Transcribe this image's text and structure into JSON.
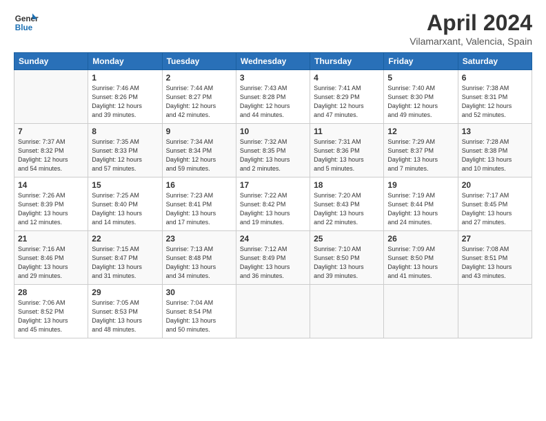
{
  "header": {
    "logo_line1": "General",
    "logo_line2": "Blue",
    "title": "April 2024",
    "subtitle": "Vilamarxant, Valencia, Spain"
  },
  "days_of_week": [
    "Sunday",
    "Monday",
    "Tuesday",
    "Wednesday",
    "Thursday",
    "Friday",
    "Saturday"
  ],
  "weeks": [
    [
      {
        "day": "",
        "info": ""
      },
      {
        "day": "1",
        "info": "Sunrise: 7:46 AM\nSunset: 8:26 PM\nDaylight: 12 hours\nand 39 minutes."
      },
      {
        "day": "2",
        "info": "Sunrise: 7:44 AM\nSunset: 8:27 PM\nDaylight: 12 hours\nand 42 minutes."
      },
      {
        "day": "3",
        "info": "Sunrise: 7:43 AM\nSunset: 8:28 PM\nDaylight: 12 hours\nand 44 minutes."
      },
      {
        "day": "4",
        "info": "Sunrise: 7:41 AM\nSunset: 8:29 PM\nDaylight: 12 hours\nand 47 minutes."
      },
      {
        "day": "5",
        "info": "Sunrise: 7:40 AM\nSunset: 8:30 PM\nDaylight: 12 hours\nand 49 minutes."
      },
      {
        "day": "6",
        "info": "Sunrise: 7:38 AM\nSunset: 8:31 PM\nDaylight: 12 hours\nand 52 minutes."
      }
    ],
    [
      {
        "day": "7",
        "info": "Sunrise: 7:37 AM\nSunset: 8:32 PM\nDaylight: 12 hours\nand 54 minutes."
      },
      {
        "day": "8",
        "info": "Sunrise: 7:35 AM\nSunset: 8:33 PM\nDaylight: 12 hours\nand 57 minutes."
      },
      {
        "day": "9",
        "info": "Sunrise: 7:34 AM\nSunset: 8:34 PM\nDaylight: 12 hours\nand 59 minutes."
      },
      {
        "day": "10",
        "info": "Sunrise: 7:32 AM\nSunset: 8:35 PM\nDaylight: 13 hours\nand 2 minutes."
      },
      {
        "day": "11",
        "info": "Sunrise: 7:31 AM\nSunset: 8:36 PM\nDaylight: 13 hours\nand 5 minutes."
      },
      {
        "day": "12",
        "info": "Sunrise: 7:29 AM\nSunset: 8:37 PM\nDaylight: 13 hours\nand 7 minutes."
      },
      {
        "day": "13",
        "info": "Sunrise: 7:28 AM\nSunset: 8:38 PM\nDaylight: 13 hours\nand 10 minutes."
      }
    ],
    [
      {
        "day": "14",
        "info": "Sunrise: 7:26 AM\nSunset: 8:39 PM\nDaylight: 13 hours\nand 12 minutes."
      },
      {
        "day": "15",
        "info": "Sunrise: 7:25 AM\nSunset: 8:40 PM\nDaylight: 13 hours\nand 14 minutes."
      },
      {
        "day": "16",
        "info": "Sunrise: 7:23 AM\nSunset: 8:41 PM\nDaylight: 13 hours\nand 17 minutes."
      },
      {
        "day": "17",
        "info": "Sunrise: 7:22 AM\nSunset: 8:42 PM\nDaylight: 13 hours\nand 19 minutes."
      },
      {
        "day": "18",
        "info": "Sunrise: 7:20 AM\nSunset: 8:43 PM\nDaylight: 13 hours\nand 22 minutes."
      },
      {
        "day": "19",
        "info": "Sunrise: 7:19 AM\nSunset: 8:44 PM\nDaylight: 13 hours\nand 24 minutes."
      },
      {
        "day": "20",
        "info": "Sunrise: 7:17 AM\nSunset: 8:45 PM\nDaylight: 13 hours\nand 27 minutes."
      }
    ],
    [
      {
        "day": "21",
        "info": "Sunrise: 7:16 AM\nSunset: 8:46 PM\nDaylight: 13 hours\nand 29 minutes."
      },
      {
        "day": "22",
        "info": "Sunrise: 7:15 AM\nSunset: 8:47 PM\nDaylight: 13 hours\nand 31 minutes."
      },
      {
        "day": "23",
        "info": "Sunrise: 7:13 AM\nSunset: 8:48 PM\nDaylight: 13 hours\nand 34 minutes."
      },
      {
        "day": "24",
        "info": "Sunrise: 7:12 AM\nSunset: 8:49 PM\nDaylight: 13 hours\nand 36 minutes."
      },
      {
        "day": "25",
        "info": "Sunrise: 7:10 AM\nSunset: 8:50 PM\nDaylight: 13 hours\nand 39 minutes."
      },
      {
        "day": "26",
        "info": "Sunrise: 7:09 AM\nSunset: 8:50 PM\nDaylight: 13 hours\nand 41 minutes."
      },
      {
        "day": "27",
        "info": "Sunrise: 7:08 AM\nSunset: 8:51 PM\nDaylight: 13 hours\nand 43 minutes."
      }
    ],
    [
      {
        "day": "28",
        "info": "Sunrise: 7:06 AM\nSunset: 8:52 PM\nDaylight: 13 hours\nand 45 minutes."
      },
      {
        "day": "29",
        "info": "Sunrise: 7:05 AM\nSunset: 8:53 PM\nDaylight: 13 hours\nand 48 minutes."
      },
      {
        "day": "30",
        "info": "Sunrise: 7:04 AM\nSunset: 8:54 PM\nDaylight: 13 hours\nand 50 minutes."
      },
      {
        "day": "",
        "info": ""
      },
      {
        "day": "",
        "info": ""
      },
      {
        "day": "",
        "info": ""
      },
      {
        "day": "",
        "info": ""
      }
    ]
  ]
}
